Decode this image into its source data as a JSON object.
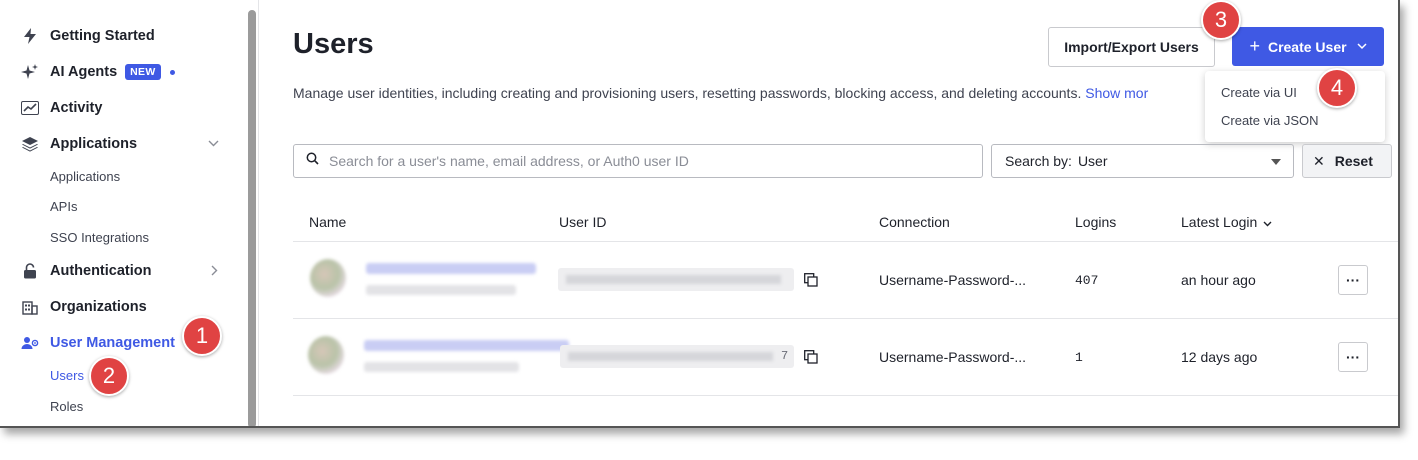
{
  "sidebar": {
    "items": [
      {
        "label": "Getting Started",
        "icon": "lightning-icon"
      },
      {
        "label": "AI Agents",
        "icon": "sparkle-icon",
        "badge": "NEW"
      },
      {
        "label": "Activity",
        "icon": "activity-chart-icon"
      },
      {
        "label": "Applications",
        "icon": "layers-icon"
      },
      {
        "label": "Authentication",
        "icon": "lock-icon"
      },
      {
        "label": "Organizations",
        "icon": "building-icon"
      },
      {
        "label": "User Management",
        "icon": "users-gear-icon"
      }
    ],
    "applications_sub": [
      "Applications",
      "APIs",
      "SSO Integrations"
    ],
    "user_management_sub": [
      "Users",
      "Roles"
    ]
  },
  "header": {
    "title": "Users",
    "description": "Manage user identities, including creating and provisioning users, resetting passwords, blocking access, and deleting accounts.",
    "show_more": "Show mor",
    "import_export_label": "Import/Export Users",
    "create_user_label": "Create User"
  },
  "create_menu": [
    "Create via UI",
    "Create via JSON"
  ],
  "search": {
    "placeholder": "Search for a user's name, email address, or Auth0 user ID",
    "search_by_label": "Search by:",
    "search_by_value": "User",
    "reset_label": "Reset"
  },
  "table": {
    "columns": [
      "Name",
      "User ID",
      "Connection",
      "Logins",
      "Latest Login"
    ],
    "rows": [
      {
        "user_id_suffix": "",
        "connection": "Username-Password-...",
        "logins": "407",
        "latest_login": "an hour ago"
      },
      {
        "user_id_suffix": "7",
        "connection": "Username-Password-...",
        "logins": "1",
        "latest_login": "12 days ago"
      }
    ],
    "row_menu": "···"
  },
  "callouts": [
    "1",
    "2",
    "3",
    "4"
  ],
  "colors": {
    "accent": "#3f59e4",
    "callout": "#e04343",
    "text": "#1e212a"
  }
}
